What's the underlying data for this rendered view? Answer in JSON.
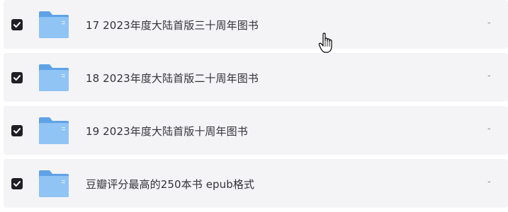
{
  "files": [
    {
      "name": "17 2023年度大陆首版三十周年图书",
      "checked": true,
      "meta": "-",
      "icon": "folder-icon"
    },
    {
      "name": "18 2023年度大陆首版二十周年图书",
      "checked": true,
      "meta": "-",
      "icon": "folder-icon"
    },
    {
      "name": "19 2023年度大陆首版十周年图书",
      "checked": true,
      "meta": "-",
      "icon": "folder-icon"
    },
    {
      "name": "豆瓣评分最高的250本书 epub格式",
      "checked": true,
      "meta": "-",
      "icon": "folder-icon"
    }
  ],
  "colors": {
    "row_background": "#f4f4f7",
    "checkbox_fill": "#1f1f24",
    "folder_back": "#5fa2e6",
    "folder_front": "#8fc4f5",
    "text": "#333338"
  },
  "cursor": "hand-pointer-icon"
}
